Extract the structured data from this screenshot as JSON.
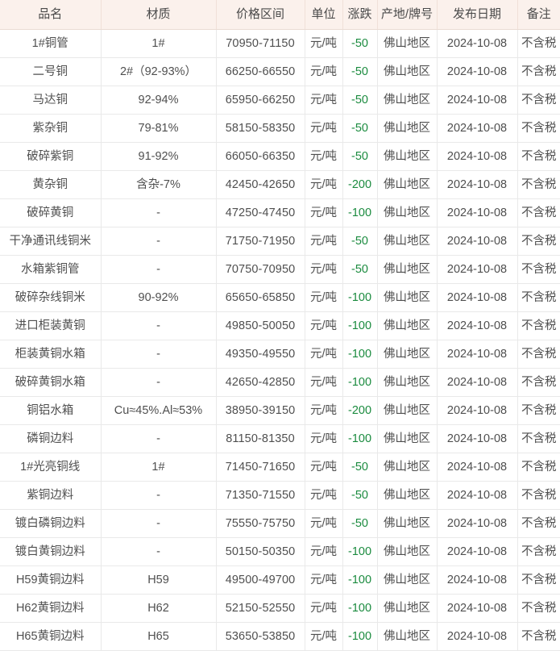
{
  "table": {
    "columns": [
      {
        "key": "name",
        "label": "品名"
      },
      {
        "key": "mat",
        "label": "材质"
      },
      {
        "key": "price",
        "label": "价格区间"
      },
      {
        "key": "unit",
        "label": "单位"
      },
      {
        "key": "change",
        "label": "涨跌"
      },
      {
        "key": "origin",
        "label": "产地/牌号"
      },
      {
        "key": "date",
        "label": "发布日期"
      },
      {
        "key": "remark",
        "label": "备注"
      }
    ],
    "colors": {
      "header_background": "#fbf1ec",
      "header_text": "#4a4a4a",
      "cell_text": "#4f4f4f",
      "grid_line": "#e9e9e9",
      "change_down": "#1b8b3f",
      "change_up": "#d0342c"
    },
    "rows": [
      {
        "name": "1#铜管",
        "mat": "1#",
        "price": "70950-71150",
        "unit": "元/吨",
        "change": "-50",
        "change_dir": "down",
        "origin": "佛山地区",
        "date": "2024-10-08",
        "remark": "不含税"
      },
      {
        "name": "二号铜",
        "mat": "2#（92-93%）",
        "price": "66250-66550",
        "unit": "元/吨",
        "change": "-50",
        "change_dir": "down",
        "origin": "佛山地区",
        "date": "2024-10-08",
        "remark": "不含税"
      },
      {
        "name": "马达铜",
        "mat": "92-94%",
        "price": "65950-66250",
        "unit": "元/吨",
        "change": "-50",
        "change_dir": "down",
        "origin": "佛山地区",
        "date": "2024-10-08",
        "remark": "不含税"
      },
      {
        "name": "紫杂铜",
        "mat": "79-81%",
        "price": "58150-58350",
        "unit": "元/吨",
        "change": "-50",
        "change_dir": "down",
        "origin": "佛山地区",
        "date": "2024-10-08",
        "remark": "不含税"
      },
      {
        "name": "破碎紫铜",
        "mat": "91-92%",
        "price": "66050-66350",
        "unit": "元/吨",
        "change": "-50",
        "change_dir": "down",
        "origin": "佛山地区",
        "date": "2024-10-08",
        "remark": "不含税"
      },
      {
        "name": "黄杂铜",
        "mat": "含杂-7%",
        "price": "42450-42650",
        "unit": "元/吨",
        "change": "-200",
        "change_dir": "down",
        "origin": "佛山地区",
        "date": "2024-10-08",
        "remark": "不含税"
      },
      {
        "name": "破碎黄铜",
        "mat": "-",
        "price": "47250-47450",
        "unit": "元/吨",
        "change": "-100",
        "change_dir": "down",
        "origin": "佛山地区",
        "date": "2024-10-08",
        "remark": "不含税"
      },
      {
        "name": "干净通讯线铜米",
        "mat": "-",
        "price": "71750-71950",
        "unit": "元/吨",
        "change": "-50",
        "change_dir": "down",
        "origin": "佛山地区",
        "date": "2024-10-08",
        "remark": "不含税"
      },
      {
        "name": "水箱紫铜管",
        "mat": "-",
        "price": "70750-70950",
        "unit": "元/吨",
        "change": "-50",
        "change_dir": "down",
        "origin": "佛山地区",
        "date": "2024-10-08",
        "remark": "不含税"
      },
      {
        "name": "破碎杂线铜米",
        "mat": "90-92%",
        "price": "65650-65850",
        "unit": "元/吨",
        "change": "-100",
        "change_dir": "down",
        "origin": "佛山地区",
        "date": "2024-10-08",
        "remark": "不含税"
      },
      {
        "name": "进口柜装黄铜",
        "mat": "-",
        "price": "49850-50050",
        "unit": "元/吨",
        "change": "-100",
        "change_dir": "down",
        "origin": "佛山地区",
        "date": "2024-10-08",
        "remark": "不含税"
      },
      {
        "name": "柜装黄铜水箱",
        "mat": "-",
        "price": "49350-49550",
        "unit": "元/吨",
        "change": "-100",
        "change_dir": "down",
        "origin": "佛山地区",
        "date": "2024-10-08",
        "remark": "不含税"
      },
      {
        "name": "破碎黄铜水箱",
        "mat": "-",
        "price": "42650-42850",
        "unit": "元/吨",
        "change": "-100",
        "change_dir": "down",
        "origin": "佛山地区",
        "date": "2024-10-08",
        "remark": "不含税"
      },
      {
        "name": "铜铝水箱",
        "mat": "Cu≈45%.Al≈53%",
        "price": "38950-39150",
        "unit": "元/吨",
        "change": "-200",
        "change_dir": "down",
        "origin": "佛山地区",
        "date": "2024-10-08",
        "remark": "不含税"
      },
      {
        "name": "磷铜边料",
        "mat": "-",
        "price": "81150-81350",
        "unit": "元/吨",
        "change": "-100",
        "change_dir": "down",
        "origin": "佛山地区",
        "date": "2024-10-08",
        "remark": "不含税"
      },
      {
        "name": "1#光亮铜线",
        "mat": "1#",
        "price": "71450-71650",
        "unit": "元/吨",
        "change": "-50",
        "change_dir": "down",
        "origin": "佛山地区",
        "date": "2024-10-08",
        "remark": "不含税"
      },
      {
        "name": "紫铜边料",
        "mat": "-",
        "price": "71350-71550",
        "unit": "元/吨",
        "change": "-50",
        "change_dir": "down",
        "origin": "佛山地区",
        "date": "2024-10-08",
        "remark": "不含税"
      },
      {
        "name": "镀白磷铜边料",
        "mat": "-",
        "price": "75550-75750",
        "unit": "元/吨",
        "change": "-50",
        "change_dir": "down",
        "origin": "佛山地区",
        "date": "2024-10-08",
        "remark": "不含税"
      },
      {
        "name": "镀白黄铜边料",
        "mat": "-",
        "price": "50150-50350",
        "unit": "元/吨",
        "change": "-100",
        "change_dir": "down",
        "origin": "佛山地区",
        "date": "2024-10-08",
        "remark": "不含税"
      },
      {
        "name": "H59黄铜边料",
        "mat": "H59",
        "price": "49500-49700",
        "unit": "元/吨",
        "change": "-100",
        "change_dir": "down",
        "origin": "佛山地区",
        "date": "2024-10-08",
        "remark": "不含税"
      },
      {
        "name": "H62黄铜边料",
        "mat": "H62",
        "price": "52150-52550",
        "unit": "元/吨",
        "change": "-100",
        "change_dir": "down",
        "origin": "佛山地区",
        "date": "2024-10-08",
        "remark": "不含税"
      },
      {
        "name": "H65黄铜边料",
        "mat": "H65",
        "price": "53650-53850",
        "unit": "元/吨",
        "change": "-100",
        "change_dir": "down",
        "origin": "佛山地区",
        "date": "2024-10-08",
        "remark": "不含税"
      }
    ]
  }
}
